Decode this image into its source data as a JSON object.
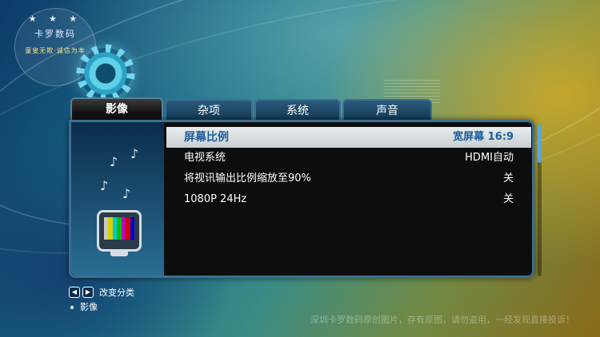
{
  "logo": {
    "stars": "★ ★ ★",
    "name": "卡罗数码",
    "motto": "童叟无欺·诚信为本"
  },
  "tabs": [
    {
      "label": "影像",
      "active": true
    },
    {
      "label": "杂项",
      "active": false
    },
    {
      "label": "系统",
      "active": false
    },
    {
      "label": "声音",
      "active": false
    }
  ],
  "settings": [
    {
      "label": "屏幕比例",
      "value": "宽屏幕 16:9",
      "selected": true
    },
    {
      "label": "电视系统",
      "value": "HDMI自动",
      "selected": false
    },
    {
      "label": "将视讯输出比例缩放至90%",
      "value": "关",
      "selected": false
    },
    {
      "label": "1080P 24Hz",
      "value": "关",
      "selected": false
    }
  ],
  "side_icons": {
    "notes": [
      "♪",
      "♪",
      "♪",
      "♪"
    ],
    "tv": "tv-icon"
  },
  "tv_bars": [
    "#c8c8c8",
    "#d8d000",
    "#00c8d0",
    "#00c000",
    "#c000c0",
    "#d00000",
    "#0000d0"
  ],
  "hint": {
    "left_key": "◀",
    "right_key": "▶",
    "text": "改变分类",
    "current": "影像"
  },
  "watermark": "深圳卡罗数码原创图片，存有原图，请勿盗用，一经发现直接投诉！",
  "colors": {
    "accent": "#1d5e9a",
    "panel_border": "#3a6f92",
    "selected_row": "#dfe3e6"
  }
}
